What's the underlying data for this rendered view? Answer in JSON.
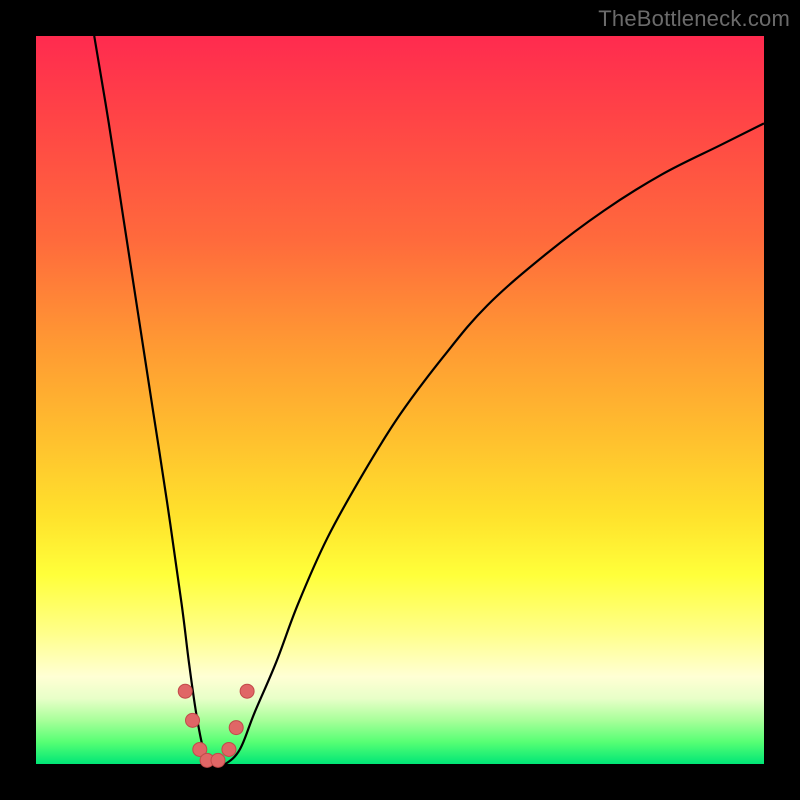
{
  "watermark": "TheBottleneck.com",
  "colors": {
    "frame": "#000000",
    "curve": "#000000",
    "marker_fill": "#e06666",
    "marker_stroke": "#c24a4a",
    "gradient_top": "#ff2b4f",
    "gradient_bottom": "#00e676"
  },
  "chart_data": {
    "type": "line",
    "title": "",
    "xlabel": "",
    "ylabel": "",
    "xlim": [
      0,
      100
    ],
    "ylim": [
      0,
      100
    ],
    "series": [
      {
        "name": "bottleneck-curve",
        "x": [
          8,
          10,
          12,
          14,
          16,
          18,
          20,
          21,
          22,
          23,
          24,
          25,
          26,
          28,
          30,
          33,
          36,
          40,
          45,
          50,
          56,
          62,
          70,
          78,
          86,
          94,
          100
        ],
        "y": [
          100,
          88,
          75,
          62,
          49,
          36,
          22,
          14,
          7,
          2,
          0,
          0,
          0,
          2,
          7,
          14,
          22,
          31,
          40,
          48,
          56,
          63,
          70,
          76,
          81,
          85,
          88
        ]
      }
    ],
    "markers": {
      "name": "highlight-points",
      "points": [
        {
          "x": 20.5,
          "y": 10
        },
        {
          "x": 21.5,
          "y": 6
        },
        {
          "x": 22.5,
          "y": 2
        },
        {
          "x": 23.5,
          "y": 0.5
        },
        {
          "x": 25.0,
          "y": 0.5
        },
        {
          "x": 26.5,
          "y": 2
        },
        {
          "x": 27.5,
          "y": 5
        },
        {
          "x": 29.0,
          "y": 10
        }
      ]
    }
  }
}
